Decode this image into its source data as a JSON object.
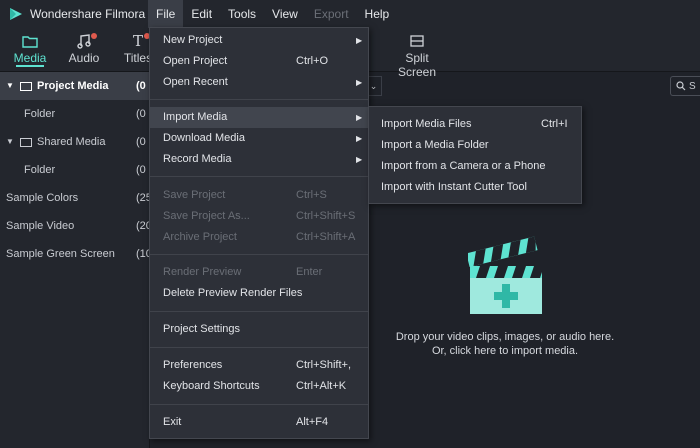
{
  "app": {
    "title": "Wondershare Filmora"
  },
  "menubar": [
    {
      "label": "File"
    },
    {
      "label": "Edit"
    },
    {
      "label": "Tools"
    },
    {
      "label": "View"
    },
    {
      "label": "Export"
    },
    {
      "label": "Help"
    }
  ],
  "toolbar": {
    "tabs": [
      {
        "label": "Media",
        "icon": "folder-icon"
      },
      {
        "label": "Audio",
        "icon": "music-note-icon"
      },
      {
        "label": "Titles",
        "icon": "text-icon"
      }
    ],
    "split_screen_label": "Split Screen"
  },
  "sidebar": {
    "items": [
      {
        "label": "Project Media",
        "count": "(0"
      },
      {
        "label": "Folder",
        "count": "(0"
      },
      {
        "label": "Shared Media",
        "count": "(0"
      },
      {
        "label": "Folder",
        "count": "(0"
      },
      {
        "label": "Sample Colors",
        "count": "(25"
      },
      {
        "label": "Sample Video",
        "count": "(20"
      },
      {
        "label": "Sample Green Screen",
        "count": "(10"
      }
    ]
  },
  "search": {
    "placeholder": "S"
  },
  "file_menu": {
    "items": [
      {
        "label": "New Project",
        "shortcut": ""
      },
      {
        "label": "Open Project",
        "shortcut": "Ctrl+O"
      },
      {
        "label": "Open Recent",
        "shortcut": ""
      },
      {
        "label": "Import Media",
        "shortcut": ""
      },
      {
        "label": "Download Media",
        "shortcut": ""
      },
      {
        "label": "Record Media",
        "shortcut": ""
      },
      {
        "label": "Save Project",
        "shortcut": "Ctrl+S"
      },
      {
        "label": "Save Project As...",
        "shortcut": "Ctrl+Shift+S"
      },
      {
        "label": "Archive Project",
        "shortcut": "Ctrl+Shift+A"
      },
      {
        "label": "Render Preview",
        "shortcut": "Enter"
      },
      {
        "label": "Delete Preview Render Files",
        "shortcut": ""
      },
      {
        "label": "Project Settings",
        "shortcut": ""
      },
      {
        "label": "Preferences",
        "shortcut": "Ctrl+Shift+,"
      },
      {
        "label": "Keyboard Shortcuts",
        "shortcut": "Ctrl+Alt+K"
      },
      {
        "label": "Exit",
        "shortcut": "Alt+F4"
      }
    ]
  },
  "import_submenu": {
    "items": [
      {
        "label": "Import Media Files",
        "shortcut": "Ctrl+I"
      },
      {
        "label": "Import a Media Folder",
        "shortcut": ""
      },
      {
        "label": "Import from a Camera or a Phone",
        "shortcut": ""
      },
      {
        "label": "Import with Instant Cutter Tool",
        "shortcut": ""
      }
    ]
  },
  "media_area": {
    "drop_line1": "Drop your video clips, images, or audio here.",
    "drop_line2": "Or, click here to import media."
  },
  "colors": {
    "accent": "#5ee3d1",
    "notification": "#e05a4e",
    "menu_bg": "#2d3038"
  }
}
